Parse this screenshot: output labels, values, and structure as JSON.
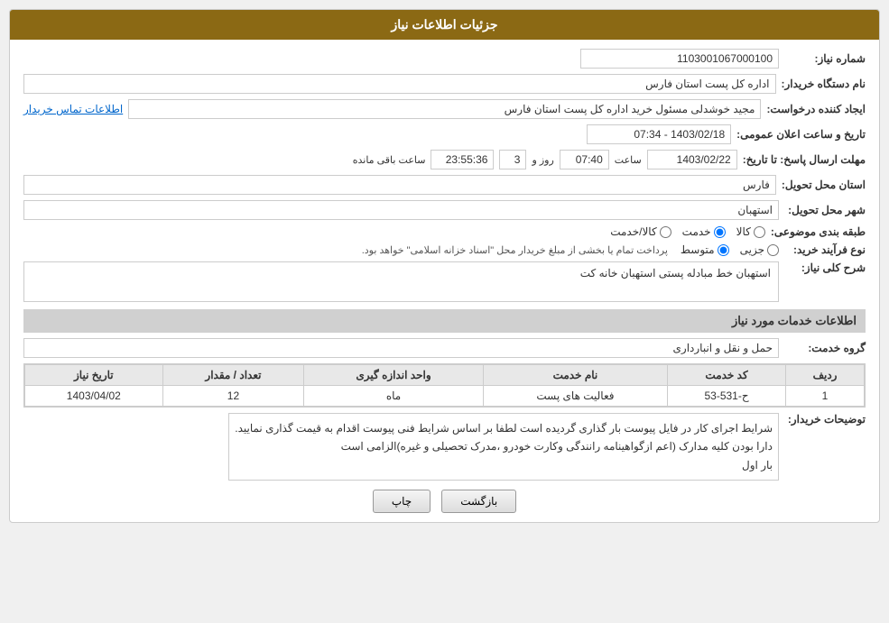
{
  "header": {
    "title": "جزئیات اطلاعات نیاز"
  },
  "fields": {
    "need_number_label": "شماره نیاز:",
    "need_number_value": "1103001067000100",
    "buyer_org_label": "نام دستگاه خریدار:",
    "buyer_org_value": "اداره کل پست استان فارس",
    "creator_label": "ایجاد کننده درخواست:",
    "creator_value": "مجید خوشدلی مسئول خرید اداره کل پست استان فارس",
    "contact_link": "اطلاعات تماس خریدار",
    "announce_date_label": "تاریخ و ساعت اعلان عمومی:",
    "announce_date_value": "1403/02/18 - 07:34",
    "deadline_label": "مهلت ارسال پاسخ: تا تاریخ:",
    "deadline_date": "1403/02/22",
    "deadline_time_label": "ساعت",
    "deadline_time": "07:40",
    "deadline_days_label": "روز و",
    "deadline_days": "3",
    "deadline_remaining_label": "ساعت باقی مانده",
    "deadline_remaining": "23:55:36",
    "province_label": "استان محل تحویل:",
    "province_value": "فارس",
    "city_label": "شهر محل تحویل:",
    "city_value": "استهبان",
    "category_label": "طبقه بندی موضوعی:",
    "category_options": [
      "کالا",
      "خدمت",
      "کالا/خدمت"
    ],
    "category_selected": "خدمت",
    "purchase_type_label": "نوع فرآیند خرید:",
    "purchase_types": [
      "جزیی",
      "متوسط"
    ],
    "purchase_note": "پرداخت تمام یا بخشی از مبلغ خریدار محل \"اسناد خزانه اسلامی\" خواهد بود.",
    "need_desc_label": "شرح کلی نیاز:",
    "need_desc_value": "استهبان خط مبادله پستی استهبان خانه کت",
    "services_section_title": "اطلاعات خدمات مورد نیاز",
    "service_group_label": "گروه خدمت:",
    "service_group_value": "حمل و نقل و انبارداری",
    "table": {
      "headers": [
        "ردیف",
        "کد خدمت",
        "نام خدمت",
        "واحد اندازه گیری",
        "تعداد / مقدار",
        "تاریخ نیاز"
      ],
      "rows": [
        {
          "row": "1",
          "code": "ح-531-53",
          "name": "فعالیت های پست",
          "unit": "ماه",
          "qty": "12",
          "date": "1403/04/02"
        }
      ]
    },
    "notes_label": "توضیحات خریدار:",
    "notes_value": "شرایط اجرای کار در فایل پیوست بار گذاری گردیده است لطفا بر اساس شرایط فنی پیوست اقدام به قیمت گذاری نمایید.\nدارا بودن کلیه مدارک (اعم ازگواهینامه رانندگی وکارت خودرو ،مدرک تحصیلی و غیره)الزامی است\nبار اول"
  },
  "buttons": {
    "back_label": "بازگشت",
    "print_label": "چاپ"
  }
}
